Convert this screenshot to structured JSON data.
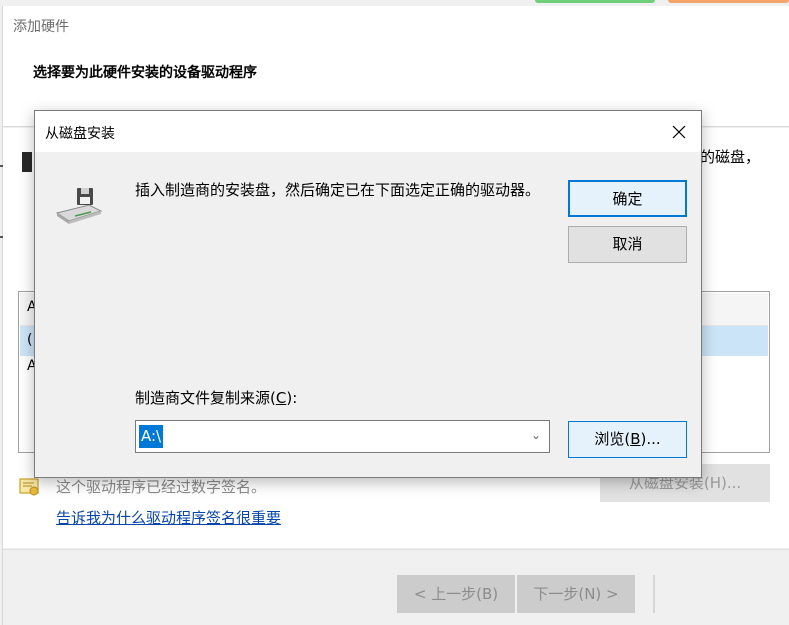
{
  "wizard": {
    "title": "添加硬件",
    "heading": "选择要为此硬件安装的设备驱动程序",
    "body_fragment": "的磁盘，",
    "list_edge_chars": [
      "A",
      "(",
      "A"
    ],
    "signature_text": "这个驱动程序已经过数字签名。",
    "signature_link": "告诉我为什么驱动程序签名很重要",
    "have_disk_button": "从磁盘安装(H)...",
    "back_button": "< 上一步(B)",
    "next_button": "下一步(N) >"
  },
  "dialog": {
    "title": "从磁盘安装",
    "message": "插入制造商的安装盘，然后确定已在下面选定正确的驱动器。",
    "ok_button": "确定",
    "cancel_button": "取消",
    "source_label_prefix": "制造商文件复制来源(",
    "source_label_key": "C",
    "source_label_suffix": "):",
    "source_value": "A:\\",
    "browse_button_prefix": "浏览(",
    "browse_button_key": "B",
    "browse_button_suffix": ")..."
  },
  "icons": {
    "close": "close-icon",
    "disk": "floppy-disk-drive-icon",
    "dropdown": "chevron-down-icon",
    "signature": "certificate-icon"
  },
  "colors": {
    "accent": "#0078d7",
    "selection": "#cce4f7",
    "link": "#0645ad"
  }
}
